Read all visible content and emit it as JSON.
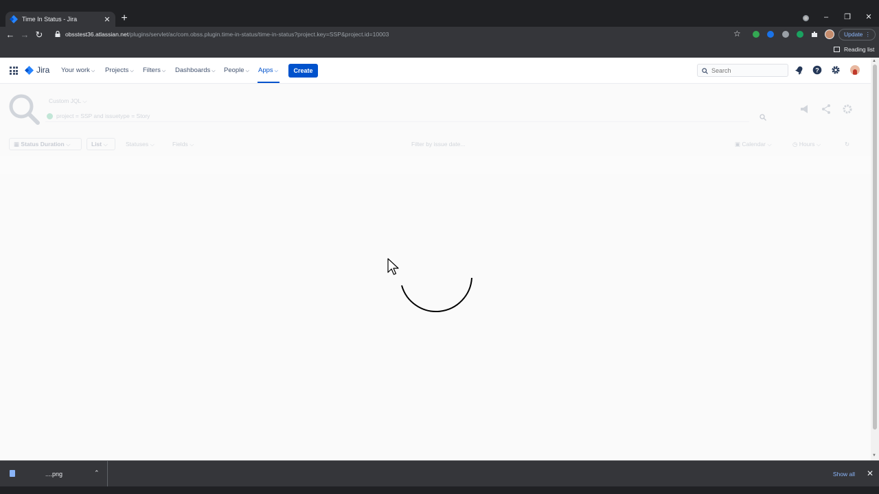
{
  "browser": {
    "tab_title": "Time In Status - Jira",
    "tab_close": "✕",
    "new_tab": "+",
    "window": {
      "minimize": "–",
      "restore": "❐",
      "close": "✕"
    },
    "url_host": "obsstest36.atlassian.net",
    "url_path": "/plugins/servlet/ac/com.obss.plugin.time-in-status/time-in-status?project.key=SSP&project.id=10003",
    "update_label": "Update",
    "reading_list_label": "Reading list",
    "extension_colors": [
      "#34a853",
      "#1a73e8",
      "#9aa0a6",
      "#1aa260"
    ]
  },
  "jira_nav": {
    "product_name": "Jira",
    "items": [
      {
        "label": "Your work"
      },
      {
        "label": "Projects"
      },
      {
        "label": "Filters"
      },
      {
        "label": "Dashboards"
      },
      {
        "label": "People"
      },
      {
        "label": "Apps",
        "active": true
      }
    ],
    "create_label": "Create",
    "search_placeholder": "Search"
  },
  "plugin": {
    "jql_type": "Custom JQL",
    "jql_query": "project = SSP and issuetype = Story",
    "report_type": "Status Duration",
    "view_mode": "List",
    "statuses_label": "Statuses",
    "fields_label": "Fields",
    "date_filter_placeholder": "Filter by issue date...",
    "calendar_label": "Calendar",
    "time_format_label": "Hours",
    "state": "loading"
  },
  "download_shelf": {
    "file_name": "....png",
    "show_all_label": "Show all"
  },
  "colors": {
    "jira_blue": "#0052cc",
    "chrome_dark": "#202124",
    "chrome_toolbar": "#35363a"
  }
}
